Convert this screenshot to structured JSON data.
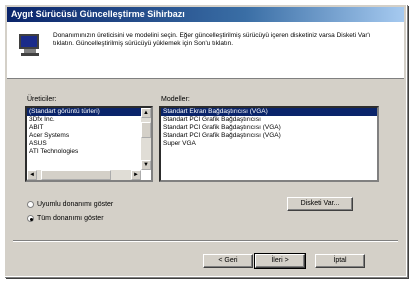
{
  "window": {
    "title": "Aygıt Sürücüsü Güncelleştirme Sihirbazı"
  },
  "header": {
    "description": "Donanımınızın üreticisini ve modelini seçin. Eğer güncelleştirilmiş sürücüyü içeren disketiniz varsa Disketi Var'ı tıklatın. Güncelleştirilmiş sürücüyü yüklemek için Son'u tıklatın.",
    "icon": "monitor-icon"
  },
  "manufacturers": {
    "label": "Üreticiler:",
    "items": [
      "(Standart görüntü türleri)",
      "3Dfx Inc.",
      "ABIT",
      "Acer Systems",
      "ASUS",
      "ATI Technologies"
    ],
    "selected_index": 0
  },
  "models": {
    "label": "Modeller:",
    "items": [
      "Standart Ekran Bağdaştırıcısı (VGA)",
      "Standart PCI Grafik Bağdaştırıcısı",
      "Standart PCI Grafik Bağdaştırıcısı (VGA)",
      "Standart PCI Grafik Bağdaştırıcısı (VGA)",
      "Super VGA"
    ],
    "selected_index": 0
  },
  "options": {
    "compatible_label": "Uyumlu donanımı göster",
    "all_label": "Tüm donanımı göster",
    "selected": "all"
  },
  "buttons": {
    "have_disk": "Disketi Var...",
    "back": "< Geri",
    "next": "İleri >",
    "cancel": "İptal"
  }
}
